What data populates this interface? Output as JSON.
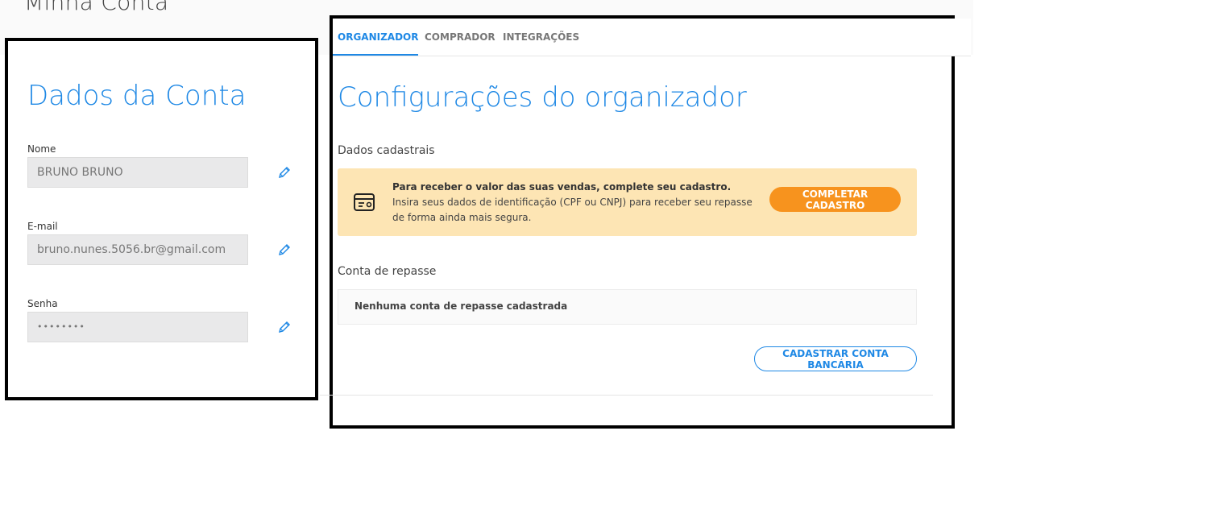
{
  "page": {
    "title": "Minha Conta"
  },
  "account": {
    "title": "Dados da Conta",
    "fields": [
      {
        "label": "Nome",
        "value": "BRUNO BRUNO"
      },
      {
        "label": "E-mail",
        "value": "bruno.nunes.5056.br@gmail.com"
      },
      {
        "label": "Senha",
        "value": "••••••••"
      }
    ],
    "edit_icon": "pencil-icon"
  },
  "tabs": [
    {
      "label": "ORGANIZADOR",
      "active": true
    },
    {
      "label": "COMPRADOR",
      "active": false
    },
    {
      "label": "INTEGRAÇÕES",
      "active": false
    }
  ],
  "organizer": {
    "title": "Configurações do organizador",
    "registration_section": "Dados cadastrais",
    "alert": {
      "icon": "id-card-icon",
      "title": "Para receber o valor das suas vendas, complete seu cadastro.",
      "text": "Insira seus dados de identificação (CPF ou CNPJ) para receber seu repasse de forma ainda mais segura.",
      "button": "COMPLETAR CADASTRO"
    },
    "payout_section": "Conta de repasse",
    "no_account": "Nenhuma conta de repasse cadastrada",
    "register_bank_button": "CADASTRAR CONTA BANCÁRIA"
  },
  "colors": {
    "accent": "#1e88e5",
    "warning_bg": "#fde5b4",
    "warning_button": "#f7931e"
  }
}
